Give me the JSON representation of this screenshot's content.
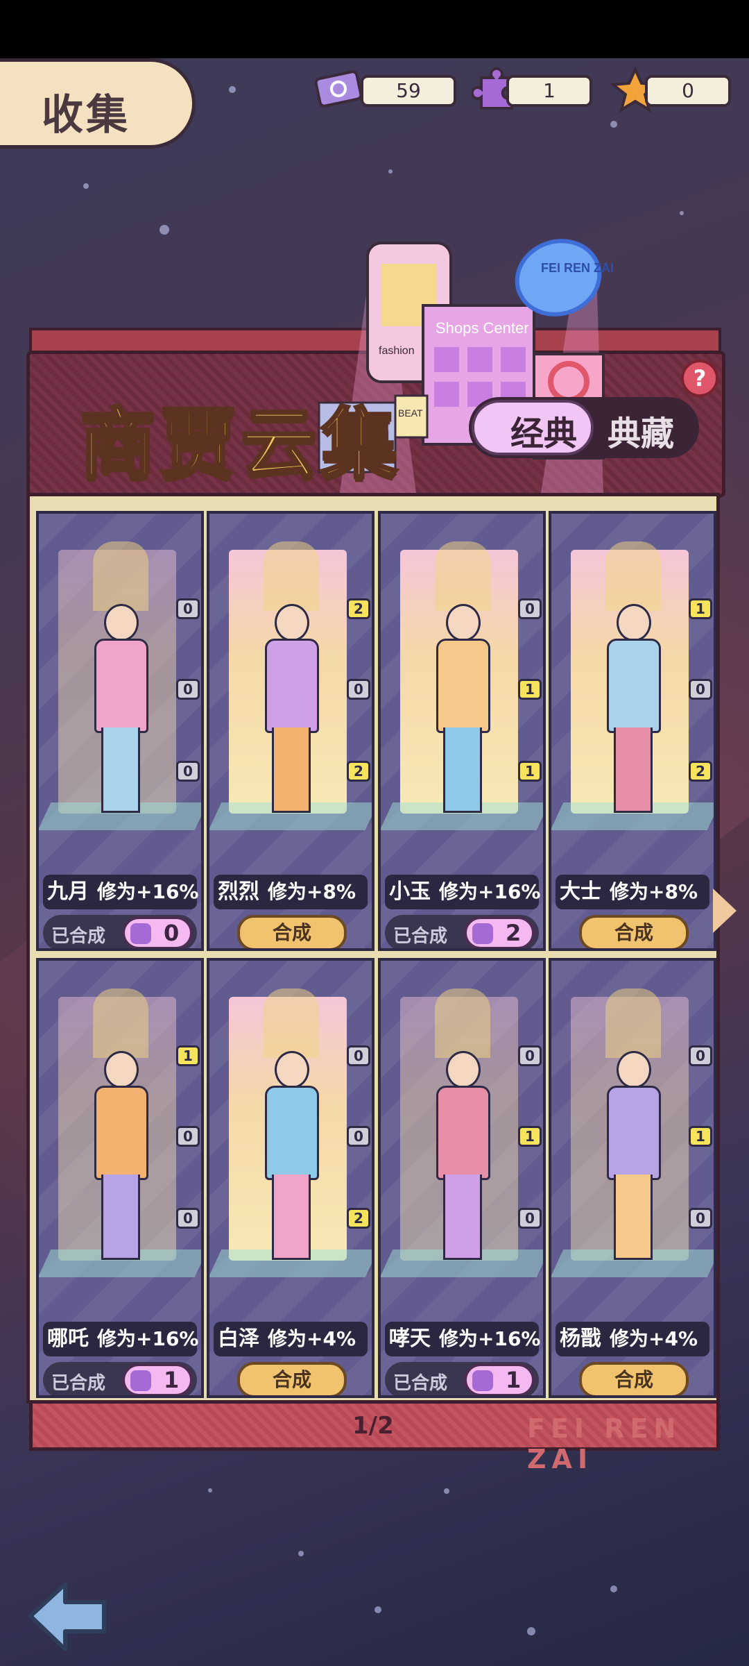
{
  "header": {
    "title": "收集",
    "resources": [
      {
        "icon": "ticket-icon",
        "value": "59"
      },
      {
        "icon": "puzzle-piece-icon",
        "value": "1"
      },
      {
        "icon": "star-icon",
        "value": "0"
      }
    ]
  },
  "banner": {
    "title": "商贾云集",
    "tabs": [
      {
        "label": "经典",
        "active": true
      },
      {
        "label": "典藏",
        "active": false
      }
    ],
    "help": "?",
    "city_signs": [
      "FEI REN ZAI",
      "Shops Center",
      "fashion",
      "BEAT"
    ]
  },
  "cards": [
    {
      "name": "九月",
      "bonus": "修为+16%",
      "status": "已合成",
      "count": "0",
      "badges": [
        "0",
        "0",
        "0"
      ],
      "tower": "faded"
    },
    {
      "name": "烈烈",
      "bonus": "修为+8%",
      "action": "合成",
      "badges": [
        "2",
        "0",
        "2"
      ],
      "tower": "solid"
    },
    {
      "name": "小玉",
      "bonus": "修为+16%",
      "status": "已合成",
      "count": "2",
      "badges": [
        "0",
        "1",
        "1"
      ],
      "tower": "solid"
    },
    {
      "name": "大士",
      "bonus": "修为+8%",
      "action": "合成",
      "badges": [
        "1",
        "0",
        "2"
      ],
      "tower": "solid"
    },
    {
      "name": "哪吒",
      "bonus": "修为+16%",
      "status": "已合成",
      "count": "1",
      "badges": [
        "1",
        "0",
        "0"
      ],
      "tower": "faded"
    },
    {
      "name": "白泽",
      "bonus": "修为+4%",
      "action": "合成",
      "badges": [
        "0",
        "0",
        "2"
      ],
      "tower": "solid"
    },
    {
      "name": "哮天",
      "bonus": "修为+16%",
      "status": "已合成",
      "count": "1",
      "badges": [
        "0",
        "1",
        "0"
      ],
      "tower": "faded"
    },
    {
      "name": "杨戬",
      "bonus": "修为+4%",
      "action": "合成",
      "badges": [
        "0",
        "1",
        "0"
      ],
      "tower": "faded"
    }
  ],
  "pager": {
    "text": "1/2",
    "watermark": "FEI REN ZAI"
  },
  "colors": {
    "gold": "#f3c95a",
    "panel": "#e8ddb0",
    "card": "#625b8f",
    "accent_pink": "#f4b9f0",
    "badge_yellow": "#f8e45c"
  }
}
